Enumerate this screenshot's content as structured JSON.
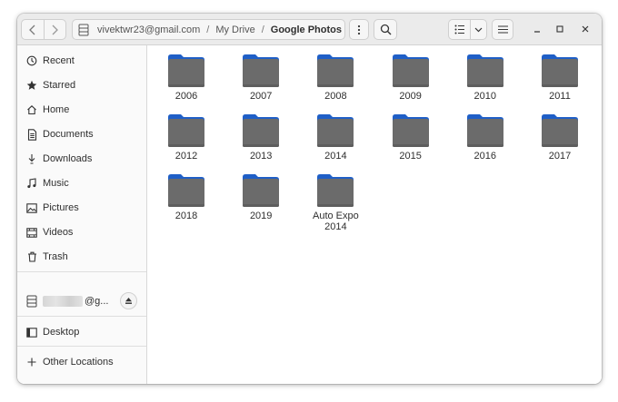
{
  "header": {
    "back_icon": "chevron-left-icon",
    "forward_icon": "chevron-right-icon",
    "breadcrumbs": [
      "vivektwr23@gmail.com",
      "My Drive",
      "Google Photos"
    ],
    "separator": "/"
  },
  "sidebar": {
    "items": [
      {
        "label": "Recent",
        "icon": "clock-icon"
      },
      {
        "label": "Starred",
        "icon": "star-icon"
      },
      {
        "label": "Home",
        "icon": "home-icon"
      },
      {
        "label": "Documents",
        "icon": "document-icon"
      },
      {
        "label": "Downloads",
        "icon": "download-icon"
      },
      {
        "label": "Music",
        "icon": "music-icon"
      },
      {
        "label": "Pictures",
        "icon": "picture-icon"
      },
      {
        "label": "Videos",
        "icon": "video-icon"
      },
      {
        "label": "Trash",
        "icon": "trash-icon"
      }
    ],
    "account": {
      "label_suffix": "@g..."
    },
    "desktop": {
      "label": "Desktop"
    },
    "other_locations": {
      "label": "Other Locations"
    }
  },
  "folders": [
    {
      "name": "2006"
    },
    {
      "name": "2007"
    },
    {
      "name": "2008"
    },
    {
      "name": "2009"
    },
    {
      "name": "2010"
    },
    {
      "name": "2011"
    },
    {
      "name": "2012"
    },
    {
      "name": "2013"
    },
    {
      "name": "2014"
    },
    {
      "name": "2015"
    },
    {
      "name": "2016"
    },
    {
      "name": "2017"
    },
    {
      "name": "2018"
    },
    {
      "name": "2019"
    },
    {
      "name": "Auto Expo\n2014"
    }
  ],
  "colors": {
    "folder_tab": "#1f5fc7",
    "folder_body": "#6b6b6b",
    "folder_body_dark": "#5e5e5e"
  }
}
